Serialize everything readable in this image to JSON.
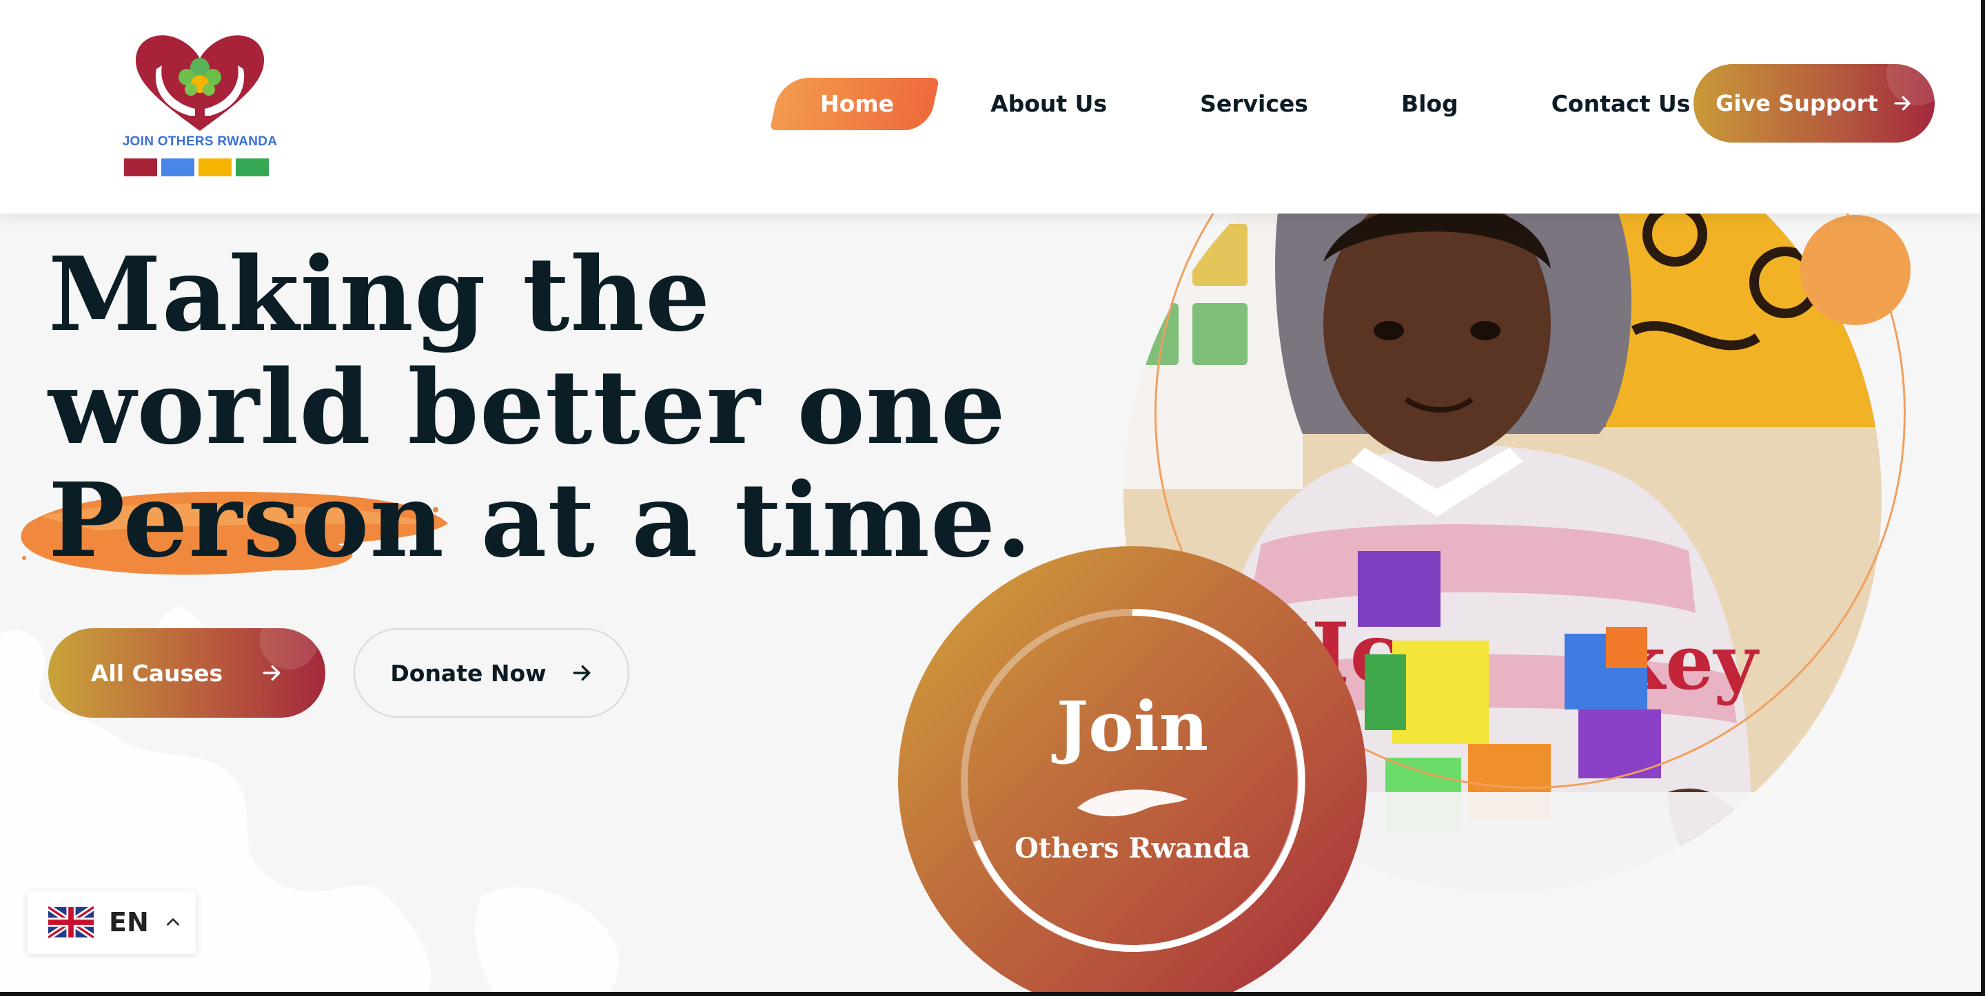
{
  "brand": {
    "logo_text": "JOIN OTHERS RWANDA",
    "logo_colors": [
      "#a8233a",
      "#4a86e8",
      "#f4b400",
      "#34a853"
    ]
  },
  "nav": {
    "items": [
      {
        "label": "Home",
        "active": true
      },
      {
        "label": "About Us"
      },
      {
        "label": "Services"
      },
      {
        "label": "Blog"
      },
      {
        "label": "Contact Us"
      }
    ],
    "cta_label": "Give Support"
  },
  "hero": {
    "headline_lines": [
      "Making the",
      "world better one",
      "Person at a time."
    ],
    "primary_button": "All Causes",
    "secondary_button": "Donate Now"
  },
  "badge": {
    "title": "Join",
    "subtitle": "Others Rwanda"
  },
  "language": {
    "code": "EN",
    "flag": "uk-flag-icon"
  },
  "colors": {
    "accent_orange": "#ee6a3b",
    "accent_gold": "#c99a38",
    "accent_red": "#a3283c",
    "heading": "#0b1e26"
  }
}
